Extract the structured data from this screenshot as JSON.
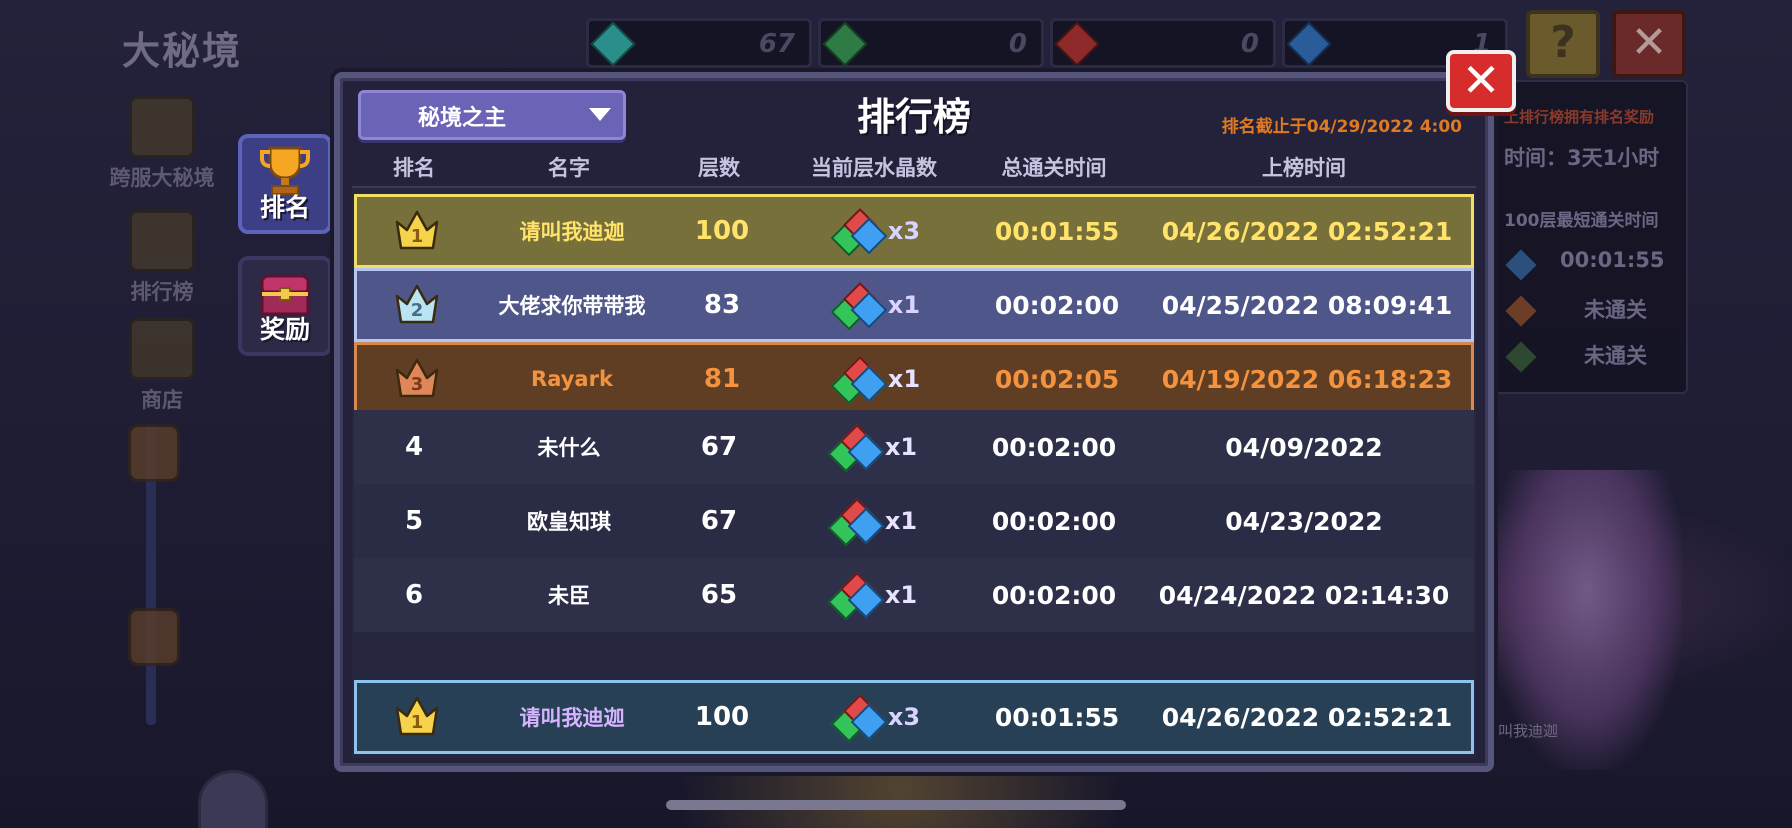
{
  "background": {
    "title": "大秘境",
    "resources": [
      {
        "value": "67",
        "color": "#2a8f8a"
      },
      {
        "value": "0",
        "color": "#2f7b45"
      },
      {
        "value": "0",
        "color": "#8e2a2a"
      },
      {
        "value": "1",
        "color": "#2a5c9a"
      }
    ],
    "help_glyph": "?",
    "close_glyph": "✕",
    "left_nav": [
      {
        "label": "跨服大秘境"
      },
      {
        "label": "排行榜"
      },
      {
        "label": "商店"
      }
    ],
    "right_panel": {
      "notice": "上排行榜拥有排名奖励",
      "time_label": "时间：3天1小时",
      "best_label": "100层最短通关时间",
      "best_time": "00:01:55",
      "status1": "未通关",
      "status2": "未通关"
    },
    "creature_name": "叫我迪迦"
  },
  "tabs": [
    {
      "label": "排名",
      "active": true
    },
    {
      "label": "奖励",
      "active": false
    }
  ],
  "dialog": {
    "dropdown_label": "秘境之主",
    "title": "排行榜",
    "deadline": "排名截止于04/29/2022 4:00",
    "close_glyph": "✕",
    "columns": {
      "rank": "排名",
      "name": "名字",
      "floor": "层数",
      "crystal": "当前层水晶数",
      "total_time": "总通关时间",
      "listed_time": "上榜时间"
    },
    "rows": [
      {
        "rank": "1",
        "name": "请叫我迪迦",
        "floor": "100",
        "crystals": "x3",
        "time": "00:01:55",
        "date": "04/26/2022 02:52:21",
        "tier": "gold"
      },
      {
        "rank": "2",
        "name": "大佬求你带带我",
        "floor": "83",
        "crystals": "x1",
        "time": "00:02:00",
        "date": "04/25/2022 08:09:41",
        "tier": "silver"
      },
      {
        "rank": "3",
        "name": "Rayark",
        "floor": "81",
        "crystals": "x1",
        "time": "00:02:05",
        "date": "04/19/2022 06:18:23",
        "tier": "bronze"
      },
      {
        "rank": "4",
        "name": "未什么",
        "floor": "67",
        "crystals": "x1",
        "time": "00:02:00",
        "date": "04/09/2022",
        "tier": "plain"
      },
      {
        "rank": "5",
        "name": "欧皇知琪",
        "floor": "67",
        "crystals": "x1",
        "time": "00:02:00",
        "date": "04/23/2022",
        "tier": "plain"
      },
      {
        "rank": "6",
        "name": "未臣",
        "floor": "65",
        "crystals": "x1",
        "time": "00:02:00",
        "date": "04/24/2022 02:14:30",
        "tier": "plain"
      }
    ],
    "my_row": {
      "rank": "1",
      "name": "请叫我迪迦",
      "floor": "100",
      "crystals": "x3",
      "time": "00:01:55",
      "date": "04/26/2022 02:52:21",
      "tier": "gold"
    }
  },
  "crown_colors": {
    "gold": "#f5d34a",
    "silver": "#b9e4f2",
    "bronze": "#e0875a"
  }
}
